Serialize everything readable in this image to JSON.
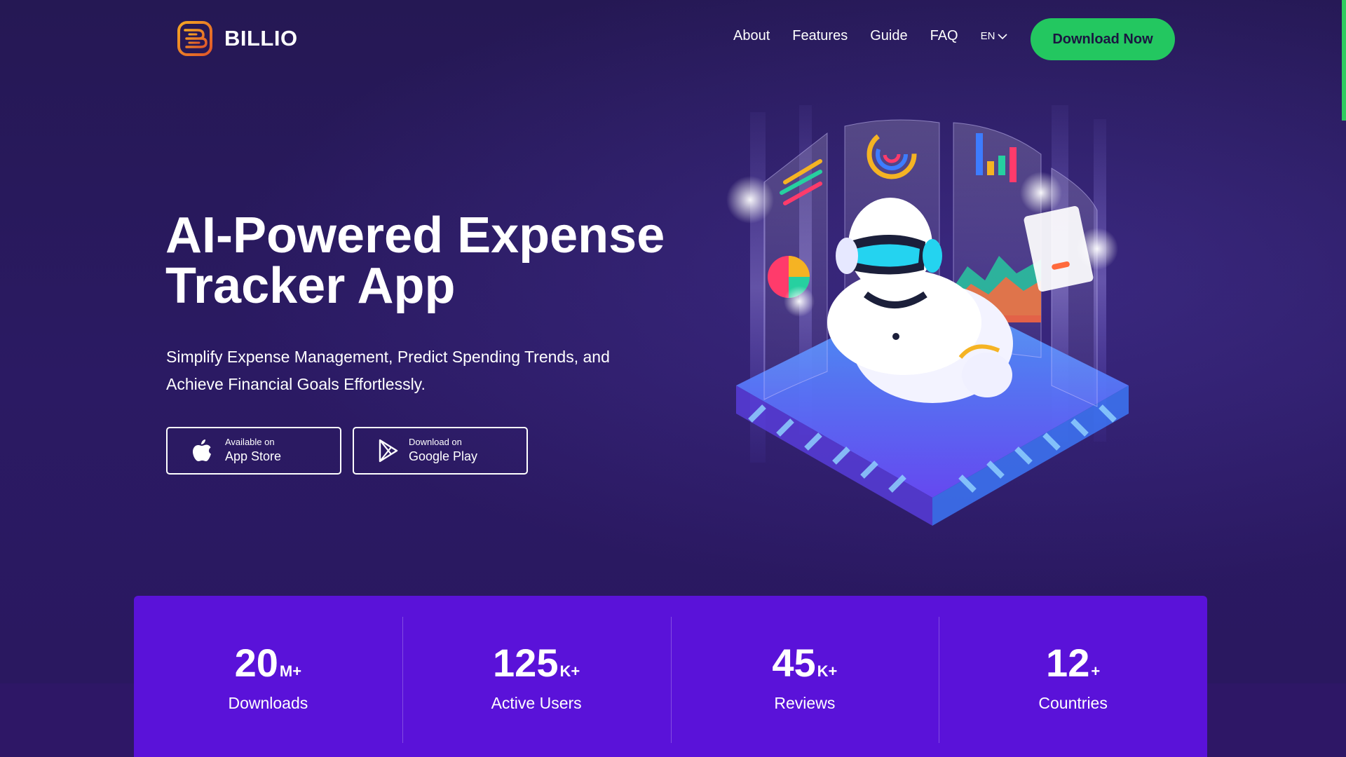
{
  "brand": {
    "name": "BILLIO"
  },
  "nav": {
    "items": [
      "About",
      "Features",
      "Guide",
      "FAQ"
    ],
    "language": "EN",
    "cta": "Download Now"
  },
  "hero": {
    "title_line1": "AI-Powered Expense",
    "title_line2": "Tracker App",
    "subtitle_line1": "Simplify Expense Management, Predict Spending Trends, and",
    "subtitle_line2": "Achieve Financial Goals Effortlessly.",
    "app_store": {
      "small": "Available on",
      "big": "App Store",
      "icon": "apple-icon"
    },
    "google_play": {
      "small": "Download on",
      "big": "Google Play",
      "icon": "google-play-icon"
    }
  },
  "stats": [
    {
      "value": "20",
      "suffix": "M+",
      "label": "Downloads"
    },
    {
      "value": "125",
      "suffix": "K+",
      "label": "Active Users"
    },
    {
      "value": "45",
      "suffix": "K+",
      "label": "Reviews"
    },
    {
      "value": "12",
      "suffix": "+",
      "label": "Countries"
    }
  ],
  "colors": {
    "background": "#2a1a5c",
    "cta": "#23c760",
    "stats_band": "#5a12d9"
  }
}
